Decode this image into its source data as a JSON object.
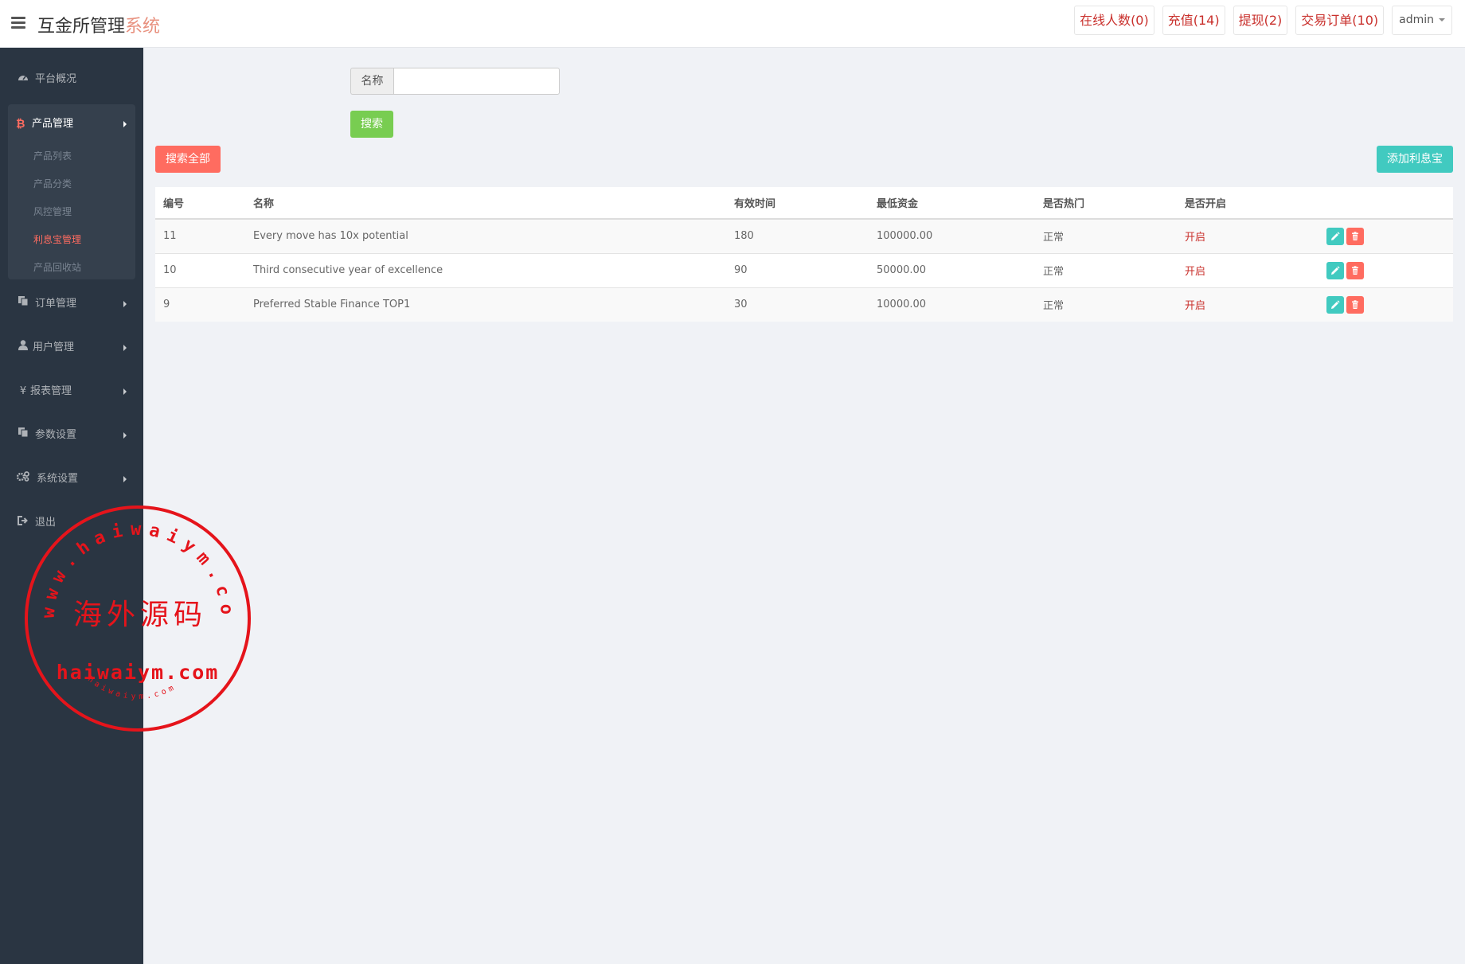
{
  "header": {
    "title": "互金所管理",
    "title_accent": "系统",
    "online": "在线人数(0)",
    "recharge": "充值(14)",
    "withdraw": "提现(2)",
    "orders": "交易订单(10)",
    "user": "admin"
  },
  "sidebar": {
    "dashboard": "平台概况",
    "product_mgmt": {
      "label": "产品管理",
      "items": [
        "产品列表",
        "产品分类",
        "风控管理",
        "利息宝管理",
        "产品回收站"
      ]
    },
    "order_mgmt": "订单管理",
    "user_mgmt": "用户管理",
    "report_mgmt": "报表管理",
    "params": "参数设置",
    "system": "系统设置",
    "logout": "退出"
  },
  "search": {
    "label": "名称",
    "value": "",
    "search_button": "搜索",
    "search_all_button": "搜索全部",
    "add_button": "添加利息宝"
  },
  "table": {
    "headers": [
      "编号",
      "名称",
      "有效时间",
      "最低资金",
      "是否热门",
      "是否开启"
    ],
    "rows": [
      [
        "11",
        "Every move has 10x potential",
        "180",
        "100000.00",
        "正常",
        "开启"
      ],
      [
        "10",
        "Third consecutive year of excellence",
        "90",
        "50000.00",
        "正常",
        "开启"
      ],
      [
        "9",
        "Preferred Stable Finance TOP1",
        "30",
        "10000.00",
        "正常",
        "开启"
      ]
    ]
  },
  "watermark": {
    "top_arc": "www.haiwaiym.com",
    "center": "海外源码",
    "domain": "haiwaiym.com",
    "bottom_arc": "haiwaiym.com"
  },
  "colors": {
    "sidebar_bg": "#2a3542",
    "accent_red": "#ff6c60",
    "accent_teal": "#41cac0",
    "accent_green": "#78cd51",
    "stamp_red": "#e5141b"
  }
}
